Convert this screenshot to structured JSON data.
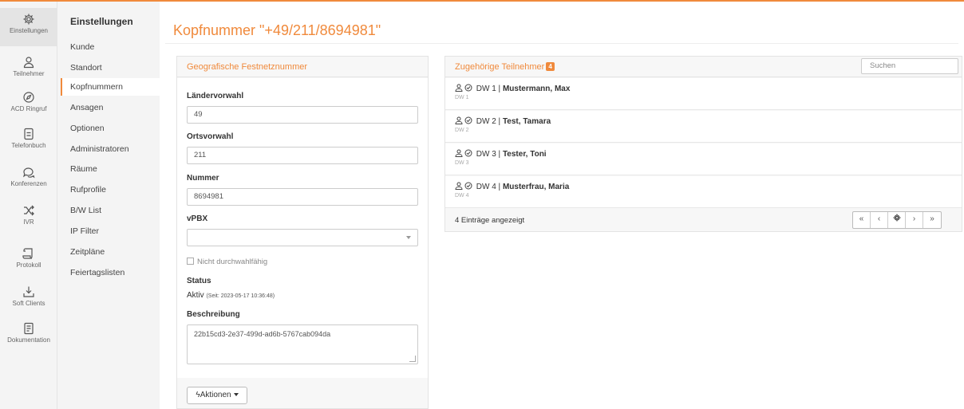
{
  "rail": [
    {
      "label": "Einstellungen",
      "icon": "gear-icon"
    },
    {
      "label": "Teilnehmer",
      "icon": "user-icon"
    },
    {
      "label": "ACD Ringruf",
      "icon": "compass-icon"
    },
    {
      "label": "Telefonbuch",
      "icon": "phonebook-icon"
    },
    {
      "label": "Konferenzen",
      "icon": "chat-icon"
    },
    {
      "label": "IVR",
      "icon": "shuffle-icon"
    },
    {
      "label": "Protokoll",
      "icon": "scroll-icon"
    },
    {
      "label": "Soft Clients",
      "icon": "download-icon"
    },
    {
      "label": "Dokumentation",
      "icon": "document-icon"
    }
  ],
  "submenu": {
    "title": "Einstellungen",
    "items": [
      "Kunde",
      "Standort",
      "Kopfnummern",
      "Ansagen",
      "Optionen",
      "Administratoren",
      "Räume",
      "Rufprofile",
      "B/W List",
      "IP Filter",
      "Zeitpläne",
      "Feiertagslisten"
    ]
  },
  "page": {
    "title": "Kopfnummer \"+49/211/8694981\""
  },
  "form": {
    "heading": "Geografische Festnetznummer",
    "country_label": "Ländervorwahl",
    "country_value": "49",
    "area_label": "Ortsvorwahl",
    "area_value": "211",
    "number_label": "Nummer",
    "number_value": "8694981",
    "vpbx_label": "vPBX",
    "vpbx_value": "",
    "no_dialin_label": "Nicht durchwahlfähig",
    "status_label": "Status",
    "status_value": "Aktiv",
    "status_since": "(Seit: 2023-05-17 10:36:48)",
    "description_label": "Beschreibung",
    "description_value": "22b15cd3-2e37-499d-ad6b-5767cab094da",
    "actions_label": "Aktionen"
  },
  "members": {
    "heading": "Zugehörige Teilnehmer",
    "count": "4",
    "search_placeholder": "Suchen",
    "items": [
      {
        "ext": "DW 1",
        "name": "Mustermann, Max",
        "sub": "DW 1"
      },
      {
        "ext": "DW 2",
        "name": "Test, Tamara",
        "sub": "DW 2"
      },
      {
        "ext": "DW 3",
        "name": "Tester, Toni",
        "sub": "DW 3"
      },
      {
        "ext": "DW 4",
        "name": "Musterfrau, Maria",
        "sub": "DW 4"
      }
    ],
    "footer": "4 Einträge angezeigt",
    "pager": {
      "first": "«",
      "prev": "‹",
      "next": "›",
      "last": "»"
    }
  }
}
